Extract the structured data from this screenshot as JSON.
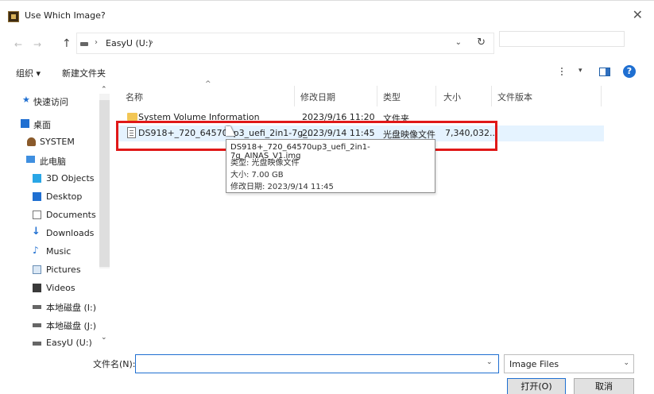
{
  "window": {
    "title": "Use Which Image?"
  },
  "nav": {
    "path": [
      "EasyU (U:)"
    ],
    "sep": "›"
  },
  "toolbar": {
    "organize": "组织 ▾",
    "new_folder": "新建文件夹"
  },
  "sidebar": {
    "items": [
      {
        "label": "快速访问",
        "icon": "star-icon"
      },
      {
        "label": "桌面",
        "icon": "desktop-icon"
      },
      {
        "label": "SYSTEM",
        "icon": "user-icon"
      },
      {
        "label": "此电脑",
        "icon": "computer-icon"
      },
      {
        "label": "3D Objects",
        "icon": "3d-objects-icon"
      },
      {
        "label": "Desktop",
        "icon": "desktop-icon"
      },
      {
        "label": "Documents",
        "icon": "documents-icon"
      },
      {
        "label": "Downloads",
        "icon": "downloads-icon"
      },
      {
        "label": "Music",
        "icon": "music-icon"
      },
      {
        "label": "Pictures",
        "icon": "pictures-icon"
      },
      {
        "label": "Videos",
        "icon": "videos-icon"
      },
      {
        "label": "本地磁盘 (I:)",
        "icon": "drive-icon"
      },
      {
        "label": "本地磁盘 (J:)",
        "icon": "drive-icon"
      },
      {
        "label": "EasyU (U:)",
        "icon": "drive-icon"
      }
    ]
  },
  "columns": {
    "name": "名称",
    "modified": "修改日期",
    "type": "类型",
    "size": "大小",
    "version": "文件版本"
  },
  "files": [
    {
      "name": "System Volume Information",
      "modified": "2023/9/16 11:20",
      "type": "文件夹",
      "size": "",
      "icon": "folder-icon"
    },
    {
      "name": "DS918+_720_64570up3_uefi_2in1-7g_...",
      "modified": "2023/9/14 11:45",
      "type": "光盘映像文件",
      "size": "7,340,032...",
      "icon": "file-icon"
    }
  ],
  "tooltip": {
    "title": "DS918+_720_64570up3_uefi_2in1-7g_AINAS_V1.img",
    "type": "类型: 光盘映像文件",
    "size": "大小: 7.00 GB",
    "modified": "修改日期: 2023/9/14 11:45"
  },
  "bottom": {
    "filename_label": "文件名(N):",
    "filename_value": "",
    "filter": "Image Files",
    "open": "打开(O)",
    "cancel": "取消"
  },
  "colors": {
    "accent": "#1f6fd1",
    "highlight": "#e01818"
  }
}
